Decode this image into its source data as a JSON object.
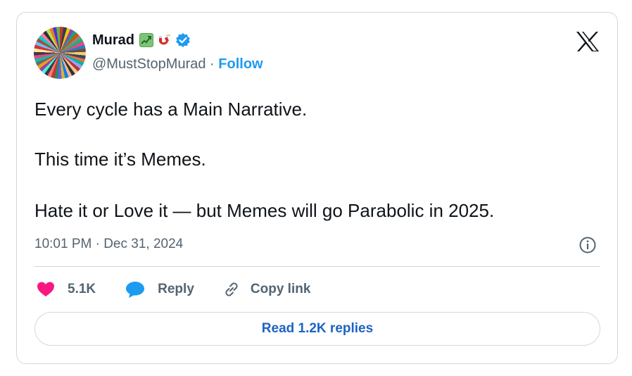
{
  "author": {
    "name": "Murad",
    "handle": "@MustStopMurad",
    "separator": "·",
    "follow_label": "Follow",
    "badges": [
      "chart-increasing-emoji",
      "magnet-emoji",
      "verified-badge"
    ]
  },
  "tweet": {
    "lines": [
      "Every cycle has a Main Narrative.",
      "This time it’s Memes.",
      "Hate it or Love it — but Memes will go Parabolic in 2025."
    ],
    "timestamp": "10:01 PM · Dec 31, 2024"
  },
  "actions": {
    "like_count": "5.1K",
    "reply_label": "Reply",
    "copy_link_label": "Copy link"
  },
  "read_replies_label": "Read 1.2K replies",
  "icons": {
    "platform": "x-logo",
    "info": "info-icon",
    "like": "heart-icon",
    "reply": "speech-bubble-icon",
    "copy": "link-icon"
  },
  "colors": {
    "follow": "#1d9bf0",
    "heart": "#f91880",
    "reply_bubble": "#1d9bf0",
    "verified": "#1d9bf0",
    "read_replies": "#1d63c4"
  }
}
